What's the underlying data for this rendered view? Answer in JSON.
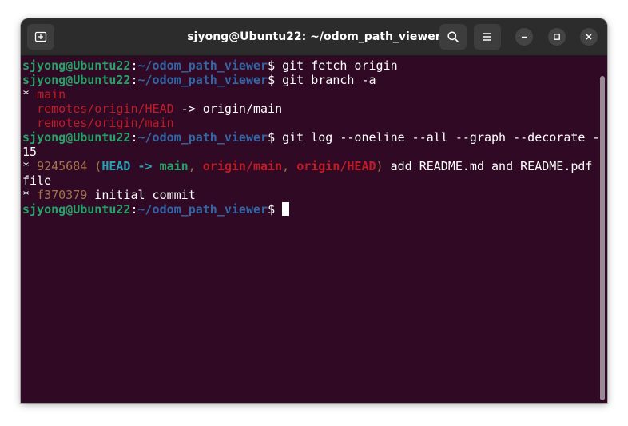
{
  "window": {
    "title": "sjyong@Ubuntu22: ~/odom_path_viewer"
  },
  "icons": {
    "new_tab": "new-tab-icon",
    "search": "search-icon",
    "menu": "hamburger-menu-icon",
    "minimize": "minimize-icon",
    "maximize": "maximize-icon",
    "close": "close-icon"
  },
  "prompt": {
    "user_host": "sjyong@Ubuntu22",
    "colon": ":",
    "path": "~/odom_path_viewer",
    "symbol": "$ "
  },
  "terminal": {
    "cmd1": "git fetch origin",
    "cmd2": "git branch -a",
    "branch_star": "* ",
    "branch_main": "main",
    "remote_head": "remotes/origin/HEAD",
    "remote_head_arrow": " -> origin/main",
    "remote_main": "remotes/origin/main",
    "cmd3_line1": "git log --oneline --all --graph --decorate -",
    "cmd3_line2": "15",
    "log1": {
      "star": "* ",
      "hash": "9245684",
      "open": " (",
      "head": "HEAD -> ",
      "main": "main",
      "sep1": ", ",
      "origin_main": "origin/main",
      "sep2": ", ",
      "origin_head": "origin/HEAD",
      "close": ")",
      "message_line1": " add README.md and README.pdf",
      "message_line2": "file"
    },
    "log2": {
      "star": "* ",
      "hash": "f370379",
      "message": " initial commit"
    }
  },
  "colors": {
    "background": "#300a24",
    "prompt_user": "#26a269",
    "prompt_path": "#3465a4",
    "remote_branch": "#c01c28",
    "hash": "#a2734c",
    "head": "#2aa1b3"
  }
}
